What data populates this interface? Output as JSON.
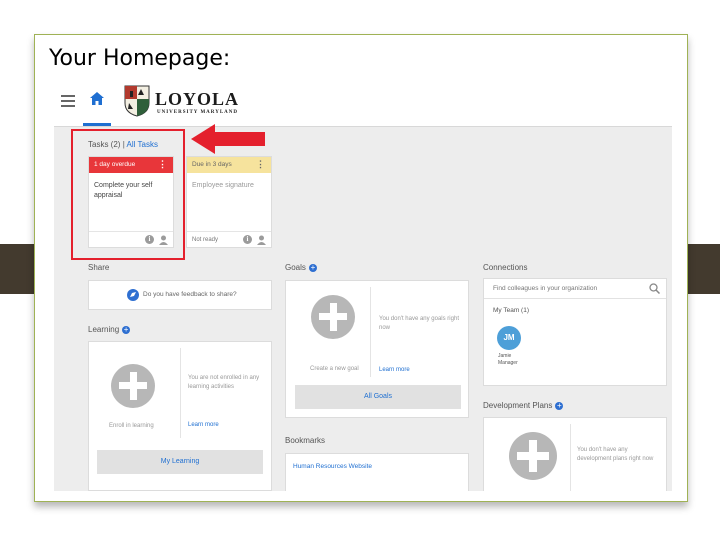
{
  "slide": {
    "title": "Your Homepage:"
  },
  "topbar": {
    "logo_word": "LOYOLA",
    "logo_sub": "UNIVERSITY MARYLAND"
  },
  "tasks": {
    "title": "Tasks (2)",
    "separator": "|",
    "all_link": "All Tasks",
    "cards": [
      {
        "status": "1 day overdue",
        "name": "Complete your self appraisal",
        "footer": "",
        "color": "#e8363a"
      },
      {
        "status": "Due in 3 days",
        "name": "Employee signature",
        "footer": "Not ready",
        "color": "#f6e39d"
      }
    ]
  },
  "share": {
    "title": "Share",
    "prompt": "Do you have feedback to share?"
  },
  "learning": {
    "title": "Learning",
    "enroll": "Enroll in learning",
    "empty_text": "You are not enrolled in any learning activities",
    "learn_more": "Learn more",
    "button": "My Learning"
  },
  "goals": {
    "title": "Goals",
    "empty_text": "You don't have any goals right now",
    "create": "Create a new goal",
    "learn_more": "Learn more",
    "button": "All Goals"
  },
  "bookmarks": {
    "title": "Bookmarks",
    "items": [
      "Human Resources Website"
    ]
  },
  "connections": {
    "title": "Connections",
    "search_placeholder": "Find colleagues in your organization",
    "team_label": "My Team (1)",
    "member": {
      "initials": "JM",
      "name": "Jamie",
      "role": "Manager"
    }
  },
  "dev_plans": {
    "title": "Development Plans",
    "empty_text": "You don't have any development plans right now"
  },
  "colors": {
    "accent": "#1f6fd1",
    "overdue": "#e8363a",
    "due_soon": "#f6e39d",
    "highlight": "#e4202d",
    "frame": "#9fb255"
  }
}
